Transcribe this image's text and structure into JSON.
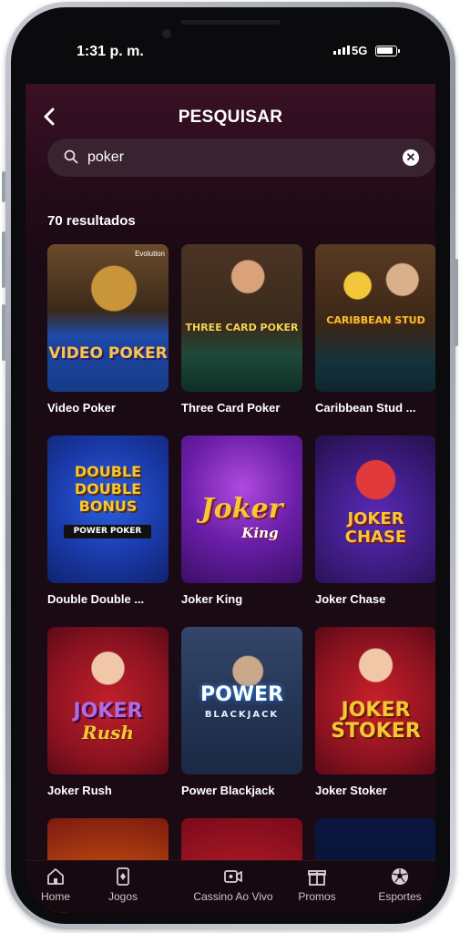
{
  "status_bar": {
    "time": "1:31 p. m.",
    "network": "5G"
  },
  "header": {
    "title": "PESQUISAR",
    "back_icon": "chevron-left-icon"
  },
  "search": {
    "value": "poker",
    "placeholder": "",
    "search_icon": "search-icon",
    "clear_icon": "close-icon"
  },
  "results": {
    "count_label": "70 resultados"
  },
  "games": [
    {
      "label": "Video Poker",
      "art_text": "VIDEO POKER",
      "provider_badge": "Evolution"
    },
    {
      "label": "Three Card Poker",
      "art_text": "THREE CARD POKER"
    },
    {
      "label": "Caribbean Stud ...",
      "art_text": "CARIBBEAN STUD"
    },
    {
      "label": "Double Double ...",
      "art_text": "DOUBLE DOUBLE BONUS",
      "art_subtext": "POWER POKER"
    },
    {
      "label": "Joker King",
      "art_text": "Joker",
      "art_subtext": "King"
    },
    {
      "label": "Joker Chase",
      "art_text": "JOKER CHASE"
    },
    {
      "label": "Joker Rush",
      "art_text": "JOKER",
      "art_subtext": "Rush"
    },
    {
      "label": "Power Blackjack",
      "art_text": "POWER",
      "art_subtext": "BLACKJACK"
    },
    {
      "label": "Joker Stoker",
      "art_text": "JOKER STOKER"
    }
  ],
  "bottom_nav": {
    "items": [
      {
        "label": "Home",
        "icon": "home-icon"
      },
      {
        "label": "Jogos",
        "icon": "cards-icon"
      },
      {
        "label": "Cassino Ao Vivo",
        "icon": "video-camera-icon"
      },
      {
        "label": "Promos",
        "icon": "gift-icon"
      },
      {
        "label": "Esportes",
        "icon": "soccer-ball-icon"
      }
    ]
  },
  "colors": {
    "background": "#1a0a13",
    "header_gradient_top": "#3a1024",
    "search_field": "#3a2330",
    "text": "#ffffff"
  }
}
